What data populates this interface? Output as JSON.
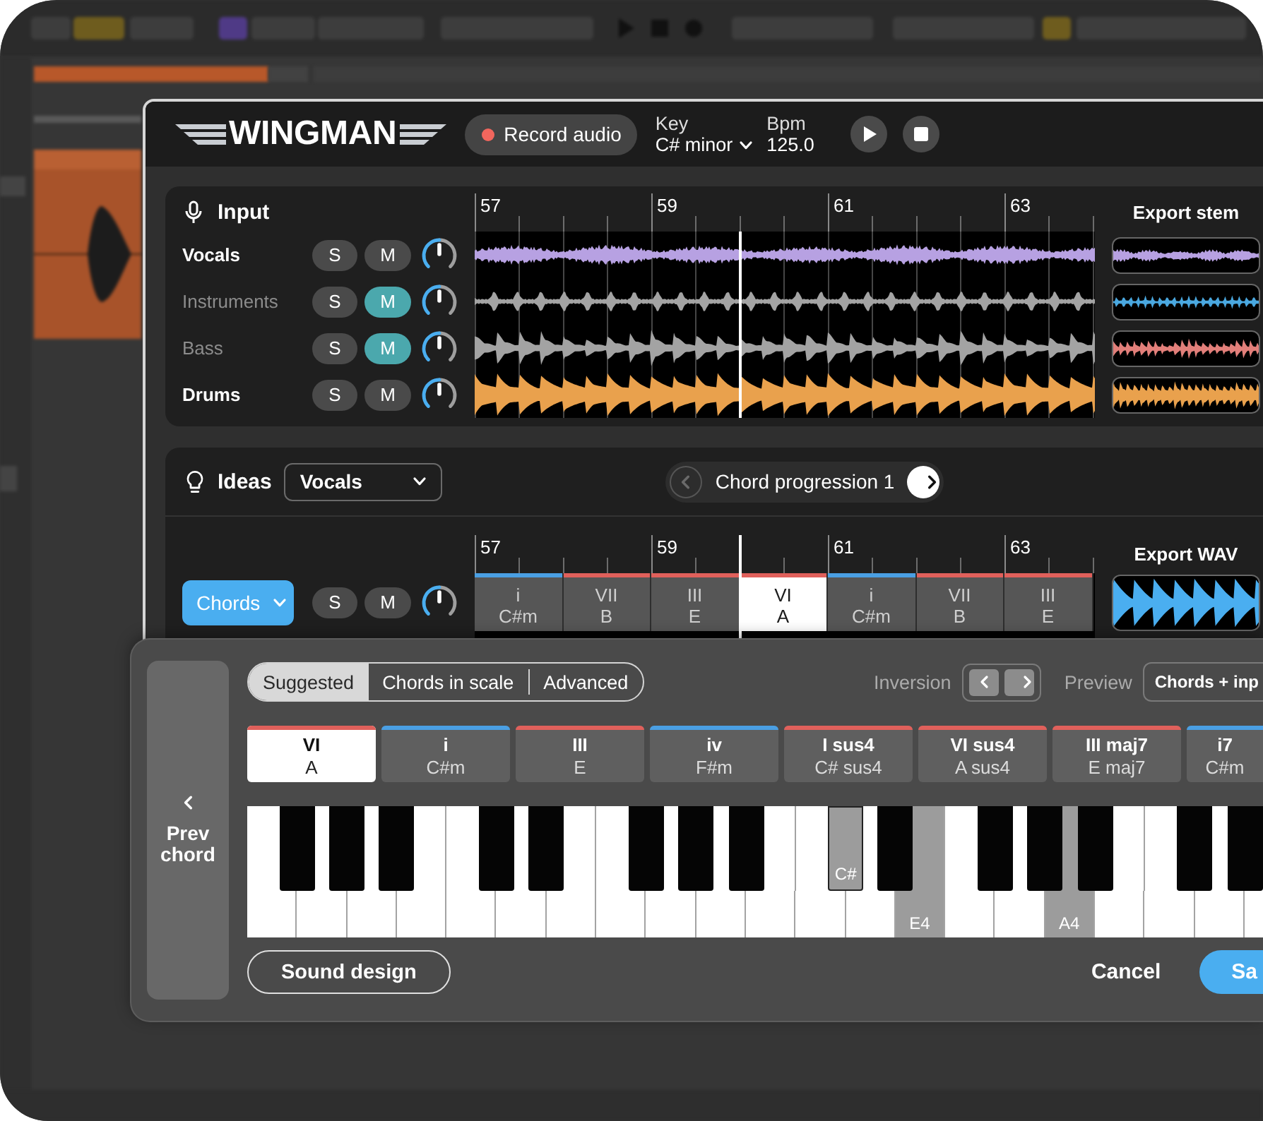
{
  "header": {
    "logo": "WINGMAN",
    "record_button": "Record audio",
    "key_label": "Key",
    "key_value": "C# minor",
    "bpm_label": "Bpm",
    "bpm_value": "125.0"
  },
  "input": {
    "title": "Input",
    "ruler": [
      "57",
      "59",
      "61",
      "63"
    ],
    "export_label": "Export stem",
    "tracks": [
      {
        "name": "Vocals",
        "solo_label": "S",
        "mute_label": "M",
        "soloed": false,
        "muted": false,
        "level": 0.5,
        "color": "#b7a1e2"
      },
      {
        "name": "Instruments",
        "solo_label": "S",
        "mute_label": "M",
        "soloed": false,
        "muted": true,
        "level": 0.5,
        "color": "#4aa8e0"
      },
      {
        "name": "Bass",
        "solo_label": "S",
        "mute_label": "M",
        "soloed": false,
        "muted": true,
        "level": 0.5,
        "color": "#e27f7a"
      },
      {
        "name": "Drums",
        "solo_label": "S",
        "mute_label": "M",
        "soloed": false,
        "muted": false,
        "level": 0.5,
        "color": "#e9a14d"
      }
    ]
  },
  "ideas": {
    "title": "Ideas",
    "source": "Vocals",
    "progression": "Chord progression 1",
    "prev_disabled": true,
    "next_disabled": false
  },
  "chords_track": {
    "button": "Chords",
    "solo_label": "S",
    "mute_label": "M",
    "soloed": false,
    "muted": false,
    "level": 0.5,
    "ruler": [
      "57",
      "59",
      "61",
      "63"
    ],
    "export_label": "Export WAV",
    "blocks": [
      {
        "numeral": "i",
        "name": "C#m",
        "color": "#4a9fe3",
        "selected": false
      },
      {
        "numeral": "VII",
        "name": "B",
        "color": "#e0605b",
        "selected": false
      },
      {
        "numeral": "III",
        "name": "E",
        "color": "#e0605b",
        "selected": false
      },
      {
        "numeral": "VI",
        "name": "A",
        "color": "#e0605b",
        "selected": true
      },
      {
        "numeral": "i",
        "name": "C#m",
        "color": "#4a9fe3",
        "selected": false
      },
      {
        "numeral": "VII",
        "name": "B",
        "color": "#e0605b",
        "selected": false
      },
      {
        "numeral": "III",
        "name": "E",
        "color": "#e0605b",
        "selected": false
      }
    ]
  },
  "chord_editor": {
    "prev_label": "Prev chord",
    "tabs": [
      {
        "label": "Suggested",
        "selected": true
      },
      {
        "label": "Chords in scale",
        "selected": false
      },
      {
        "label": "Advanced",
        "selected": false
      }
    ],
    "inversion_label": "Inversion",
    "preview_label": "Preview",
    "preview_value": "Chords + inp",
    "suggestions": [
      {
        "numeral": "VI",
        "name": "A",
        "color": "#e0605b",
        "selected": true
      },
      {
        "numeral": "i",
        "name": "C#m",
        "color": "#4a9fe3",
        "selected": false
      },
      {
        "numeral": "III",
        "name": "E",
        "color": "#e0605b",
        "selected": false
      },
      {
        "numeral": "iv",
        "name": "F#m",
        "color": "#4a9fe3",
        "selected": false
      },
      {
        "numeral": "I sus4",
        "name": "C# sus4",
        "color": "#e0605b",
        "selected": false
      },
      {
        "numeral": "VI sus4",
        "name": "A sus4",
        "color": "#e0605b",
        "selected": false
      },
      {
        "numeral": "III maj7",
        "name": "E maj7",
        "color": "#e0605b",
        "selected": false
      },
      {
        "numeral": "i7",
        "name": "C#m",
        "color": "#4a9fe3",
        "selected": false
      }
    ],
    "piano": {
      "keys": [
        {
          "kind": "white",
          "selected": false
        },
        {
          "kind": "black",
          "selected": false
        },
        {
          "kind": "white",
          "selected": false
        },
        {
          "kind": "black",
          "selected": false
        },
        {
          "kind": "white",
          "selected": false
        },
        {
          "kind": "black",
          "selected": false
        },
        {
          "kind": "white",
          "selected": false
        },
        {
          "kind": "white",
          "selected": false
        },
        {
          "kind": "black",
          "selected": false
        },
        {
          "kind": "white",
          "selected": false
        },
        {
          "kind": "black",
          "selected": false
        },
        {
          "kind": "white",
          "selected": false
        },
        {
          "kind": "white",
          "selected": false
        },
        {
          "kind": "black",
          "selected": false
        },
        {
          "kind": "white",
          "selected": false
        },
        {
          "kind": "black",
          "selected": false
        },
        {
          "kind": "white",
          "selected": false
        },
        {
          "kind": "black",
          "selected": false
        },
        {
          "kind": "white",
          "selected": false
        },
        {
          "kind": "white",
          "selected": false
        },
        {
          "kind": "black",
          "selected": true,
          "label": "C#"
        },
        {
          "kind": "white",
          "selected": false
        },
        {
          "kind": "black",
          "selected": false
        },
        {
          "kind": "white",
          "selected": true,
          "label": "E4"
        },
        {
          "kind": "white",
          "selected": false
        },
        {
          "kind": "black",
          "selected": false
        },
        {
          "kind": "white",
          "selected": false
        },
        {
          "kind": "black",
          "selected": false
        },
        {
          "kind": "white",
          "selected": true,
          "label": "A4"
        },
        {
          "kind": "black",
          "selected": false
        },
        {
          "kind": "white",
          "selected": false
        },
        {
          "kind": "white",
          "selected": false
        },
        {
          "kind": "black",
          "selected": false
        },
        {
          "kind": "white",
          "selected": false
        },
        {
          "kind": "black",
          "selected": false
        },
        {
          "kind": "white",
          "selected": false
        }
      ]
    },
    "sound_design": "Sound design",
    "cancel": "Cancel",
    "save": "Sa"
  }
}
